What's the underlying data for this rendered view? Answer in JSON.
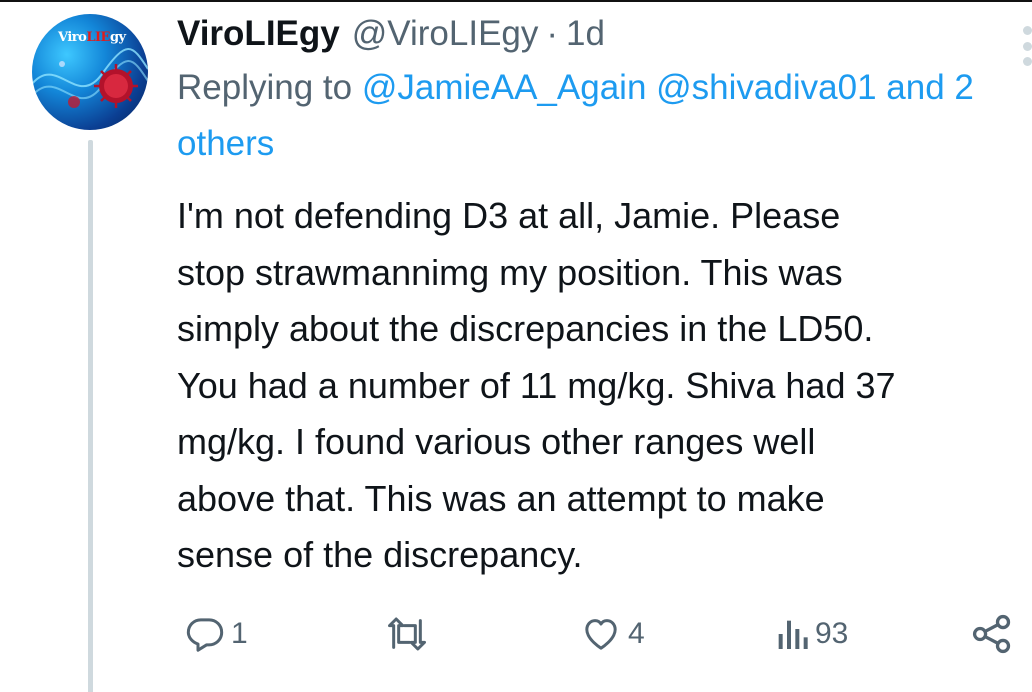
{
  "tweet": {
    "display_name": "ViroLIEgy",
    "handle": "@ViroLIEgy",
    "separator": "·",
    "time": "1d",
    "reply_prefix": "Replying to",
    "reply_mentions": [
      "@JamieAA_Again",
      "@shivadiva01"
    ],
    "reply_others": "and 2 others",
    "body_lines": [
      "I'm not defending D3 at all, Jamie. Please",
      "stop strawmannimg my position. This was",
      "simply about the discrepancies in the LD50.",
      "You had a number of 11 mg/kg. Shiva had 37",
      "mg/kg. I found various other ranges well",
      "above that. This was an attempt to make",
      "sense of the discrepancy."
    ]
  },
  "avatar": {
    "brand_text_a": "Viro",
    "brand_text_b": "LIE",
    "brand_text_c": "gy"
  },
  "actions": {
    "reply": {
      "icon": "reply-icon",
      "count": "1"
    },
    "retweet": {
      "icon": "retweet-icon",
      "count": ""
    },
    "like": {
      "icon": "heart-icon",
      "count": "4"
    },
    "views": {
      "icon": "bar-chart-icon",
      "count": "93"
    },
    "share": {
      "icon": "share-icon"
    }
  },
  "colors": {
    "text": "#0f1419",
    "secondary": "#536471",
    "link": "#1d9bf0",
    "thread_line": "#cfd9de"
  }
}
